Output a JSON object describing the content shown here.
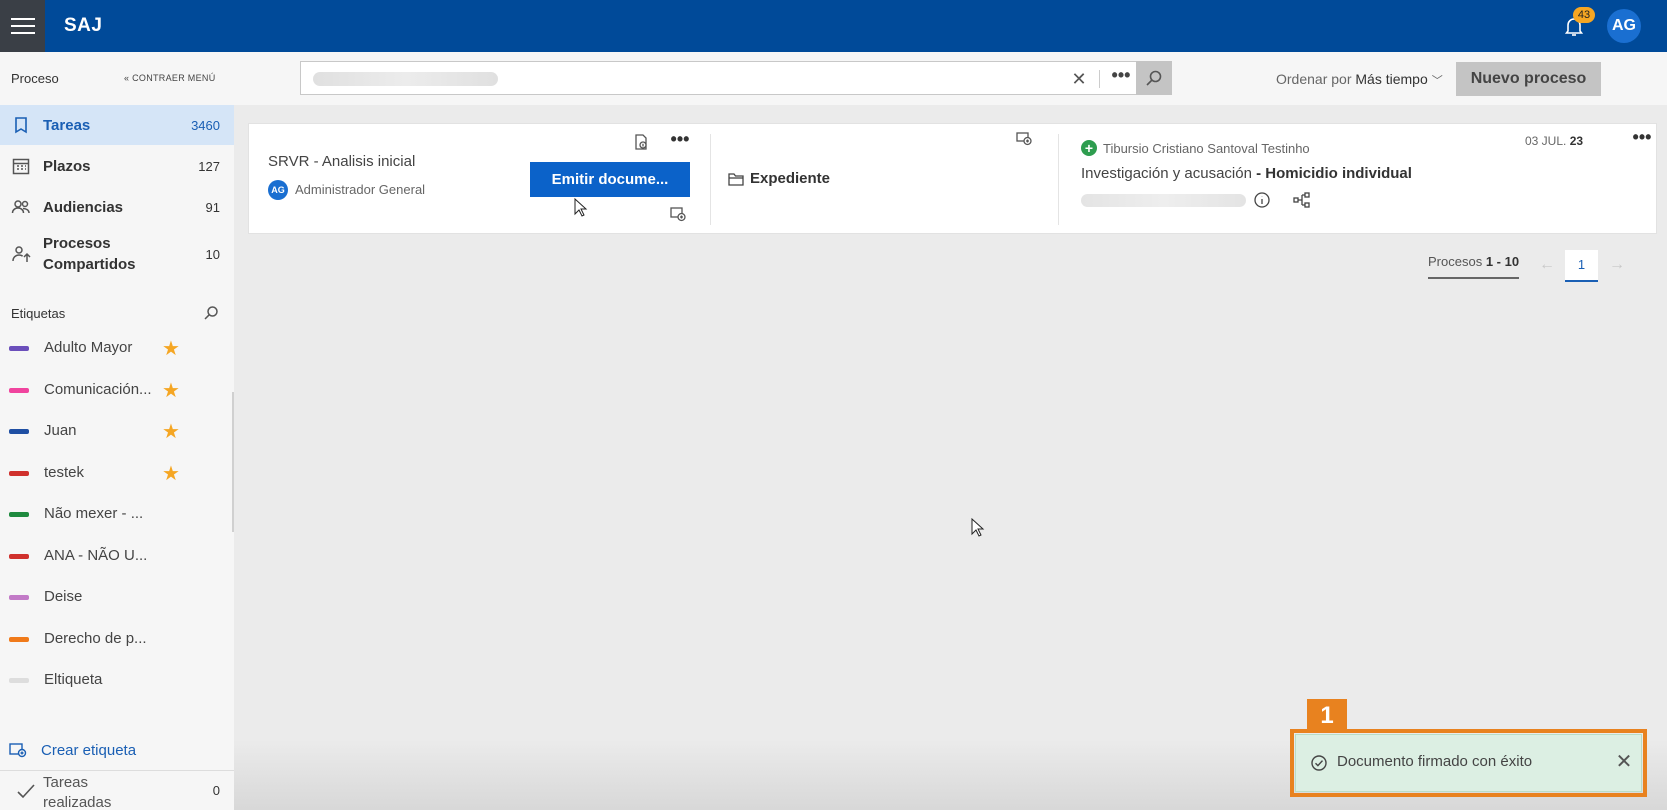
{
  "header": {
    "brand": "SAJ",
    "notifications_count": "43",
    "user_initials": "AG"
  },
  "sidebar": {
    "section_title": "Proceso",
    "collapse_label": "CONTRAER MENÚ",
    "nav": [
      {
        "label": "Tareas",
        "count": "3460",
        "icon": "bookmark-icon",
        "active": true
      },
      {
        "label": "Plazos",
        "count": "127",
        "icon": "calendar-icon",
        "active": false
      },
      {
        "label": "Audiencias",
        "count": "91",
        "icon": "people-icon",
        "active": false
      },
      {
        "label": "Procesos Compartidos",
        "label_line1": "Procesos",
        "label_line2": "Compartidos",
        "count": "10",
        "icon": "shared-user-icon",
        "active": false
      }
    ],
    "tags_title": "Etiquetas",
    "tags": [
      {
        "label": "Adulto Mayor",
        "color": "#6b4fbb",
        "starred": true
      },
      {
        "label": "Comunicación...",
        "color": "#f0449e",
        "starred": true
      },
      {
        "label": "Juan",
        "color": "#1f4fa3",
        "starred": true
      },
      {
        "label": "testek",
        "color": "#d0312d",
        "starred": true
      },
      {
        "label": "Não mexer - ...",
        "color": "#1e8a3e",
        "starred": false
      },
      {
        "label": "ANA - NÃO U...",
        "color": "#d0312d",
        "starred": false
      },
      {
        "label": "Deise",
        "color": "#c27ac7",
        "starred": false
      },
      {
        "label": "Derecho de p...",
        "color": "#f07a1a",
        "starred": false
      },
      {
        "label": "Eltiqueta",
        "color": "#dddddd",
        "starred": false
      }
    ],
    "create_tag_label": "Crear etiqueta",
    "done": {
      "label_line1": "Tareas",
      "label_line2": "realizadas",
      "count": "0"
    }
  },
  "search": {
    "value": "",
    "more_label": "•••"
  },
  "sort": {
    "prefix": "Ordenar por",
    "value": "Más tiempo"
  },
  "new_process_label": "Nuevo proceso",
  "card": {
    "task_title": "SRVR - Analisis inicial",
    "assignee_initials": "AG",
    "assignee": "Administrador General",
    "emit_button": "Emitir docume...",
    "expediente_label": "Expediente",
    "party": "Tibursio Cristiano Santoval Testinho",
    "case_prefix": "Investigación y acusación",
    "case_bold": "- Homicidio individual",
    "date_prefix": "03 JUL.",
    "date_year": "23"
  },
  "pagination": {
    "info_prefix": "Procesos",
    "info_range": "1 - 10",
    "current_page": "1",
    "prev": "←",
    "next": "→"
  },
  "toast": {
    "marker": "1",
    "message": "Documento firmado con éxito",
    "close": "✕"
  },
  "colors": {
    "header": "#004a99",
    "accent": "#0b62c9",
    "toast_bg": "#dcefe3",
    "marker": "#e8821f"
  }
}
